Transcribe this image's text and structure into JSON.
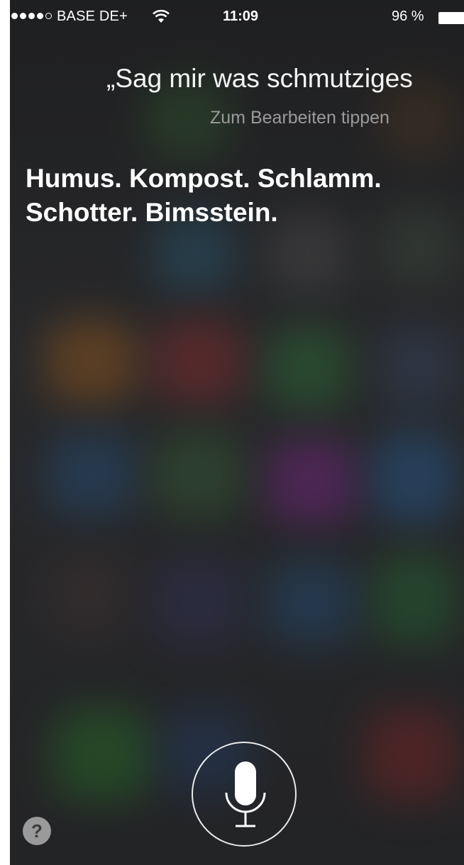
{
  "status_bar": {
    "carrier": "BASE DE+",
    "signal_bars_filled": 4,
    "signal_bars_total": 5,
    "wifi_icon": "wifi-icon",
    "time": "11:09",
    "battery_percent": "96 %",
    "battery_icon": "battery-icon"
  },
  "siri": {
    "query": "„Sag mir was schmutziges",
    "edit_hint": "Zum Bearbeiten tippen",
    "answer_lines": [
      "Humus. Kompost. Schlamm.",
      "Schotter. Bimsstein."
    ]
  },
  "controls": {
    "mic_icon": "microphone-icon",
    "help_label": "?"
  },
  "colors": {
    "background": "#2b2c2e",
    "text": "#ffffff",
    "hint_text": "#9a9a9a",
    "help_button": "#9a9a9a"
  }
}
